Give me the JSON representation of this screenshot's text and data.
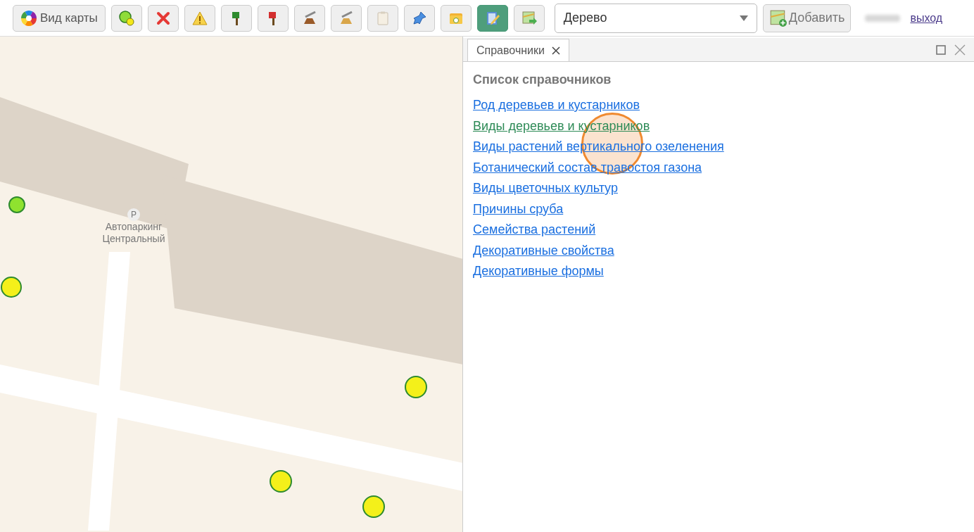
{
  "toolbar": {
    "map_view_button": {
      "label": "Вид карты"
    },
    "tools": [
      {
        "kind": "add-point",
        "selected": false
      },
      {
        "kind": "delete",
        "selected": false
      },
      {
        "kind": "warning",
        "selected": false
      },
      {
        "kind": "axe-green",
        "selected": false
      },
      {
        "kind": "axe-red",
        "selected": false
      },
      {
        "kind": "stump",
        "selected": false
      },
      {
        "kind": "stump-light",
        "selected": false
      },
      {
        "kind": "clipboard",
        "selected": false
      },
      {
        "kind": "pin",
        "selected": false
      },
      {
        "kind": "folder",
        "selected": false
      },
      {
        "kind": "edit",
        "selected": true
      },
      {
        "kind": "map-export",
        "selected": false
      }
    ],
    "layer_select": {
      "value": "Дерево"
    },
    "add_button": {
      "label": "Добавить"
    },
    "logout_link": "выход"
  },
  "map": {
    "label_icon": "P",
    "label": "Автопаркинг Центральный",
    "markers": [
      {
        "color": "#8fe22f"
      },
      {
        "color": "#f4f01a"
      },
      {
        "color": "#f4f01a"
      },
      {
        "color": "#f4f01a"
      },
      {
        "color": "#f4f01a"
      }
    ]
  },
  "panel": {
    "tab": {
      "label": "Справочники",
      "selected": true
    },
    "heading": "Список справочников",
    "links": [
      {
        "label": "Род деревьев и кустарников",
        "selected": false
      },
      {
        "label": "Виды деревьев и кустарников",
        "selected": true
      },
      {
        "label": "Виды растений вертикального озеленения",
        "selected": false
      },
      {
        "label": "Ботанический состав травостоя газона",
        "selected": false
      },
      {
        "label": "Виды цветочных культур",
        "selected": false
      },
      {
        "label": "Причины сруба",
        "selected": false
      },
      {
        "label": "Семейства растений",
        "selected": false
      },
      {
        "label": "Декоративные свойства",
        "selected": false
      },
      {
        "label": "Декоративные формы",
        "selected": false
      }
    ],
    "click_highlight": true
  }
}
